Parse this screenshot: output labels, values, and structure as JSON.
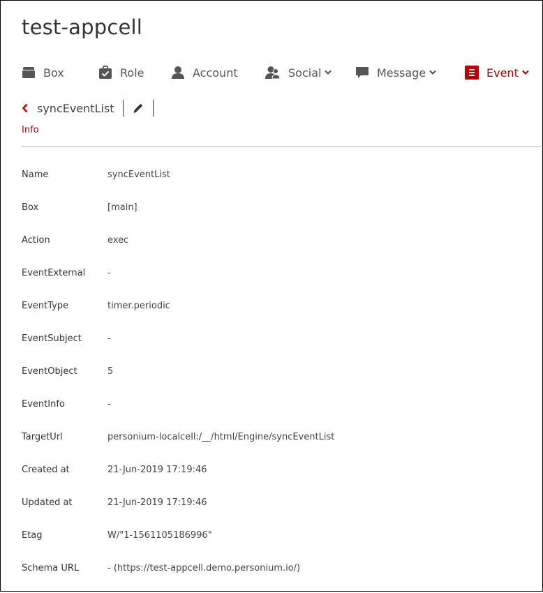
{
  "app": {
    "title": "test-appcell"
  },
  "nav": {
    "box": {
      "label": "Box",
      "icon": "box-icon"
    },
    "role": {
      "label": "Role",
      "icon": "briefcase-check-icon"
    },
    "account": {
      "label": "Account",
      "icon": "person-icon"
    },
    "social": {
      "label": "Social",
      "icon": "people-icon",
      "has_dropdown": true
    },
    "message": {
      "label": "Message",
      "icon": "speech-bubble-icon",
      "has_dropdown": true
    },
    "event": {
      "label": "Event",
      "icon": "list-icon",
      "has_dropdown": true,
      "active": true
    }
  },
  "detail": {
    "name": "syncEventList",
    "back_icon": "chevron-left-icon",
    "edit_icon": "pencil-icon",
    "tab": "Info"
  },
  "fields": [
    {
      "label": "Name",
      "value": "syncEventList"
    },
    {
      "label": "Box",
      "value": "[main]"
    },
    {
      "label": "Action",
      "value": "exec"
    },
    {
      "label": "EventExternal",
      "value": "-"
    },
    {
      "label": "EventType",
      "value": "timer.periodic"
    },
    {
      "label": "EventSubject",
      "value": "-"
    },
    {
      "label": "EventObject",
      "value": "5"
    },
    {
      "label": "EventInfo",
      "value": "-"
    },
    {
      "label": "TargetUrl",
      "value": "personium-localcell:/__/html/Engine/syncEventList"
    },
    {
      "label": "Created at",
      "value": "21-Jun-2019 17:19:46"
    },
    {
      "label": "Updated at",
      "value": "21-Jun-2019 17:19:46"
    },
    {
      "label": "Etag",
      "value": "W/\"1-1561105186996\""
    },
    {
      "label": "Schema URL",
      "value": "- (https://test-appcell.demo.personium.io/)"
    }
  ],
  "colors": {
    "accent": "#c00000",
    "text": "#333333",
    "icon": "#555555",
    "divider": "#b3b3b3"
  }
}
